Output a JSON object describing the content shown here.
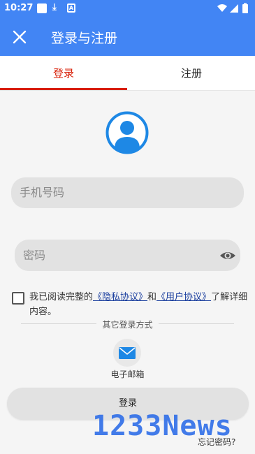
{
  "status_bar": {
    "time": "10:27",
    "adb_glyph": "A",
    "download_glyph": "⤓"
  },
  "app_bar": {
    "title": "登录与注册"
  },
  "tabs": [
    {
      "label": "登录",
      "active": true
    },
    {
      "label": "注册",
      "active": false
    }
  ],
  "form": {
    "phone_placeholder": "手机号码",
    "password_placeholder": "密码"
  },
  "agreement": {
    "prefix": "我已阅读完整的",
    "privacy_link": "《隐私协议》",
    "middle": "和",
    "user_link": "《用户协议》",
    "suffix": "了解详细内容。",
    "checked": false
  },
  "other_login": {
    "label": "其它登录方式",
    "email_label": "电子邮箱"
  },
  "login_button": "登录",
  "forgot_password": "忘记密码?",
  "watermark": "1233News",
  "colors": {
    "primary": "#4285f4",
    "accent_red": "#d81e06",
    "link": "#1a3e9e"
  }
}
